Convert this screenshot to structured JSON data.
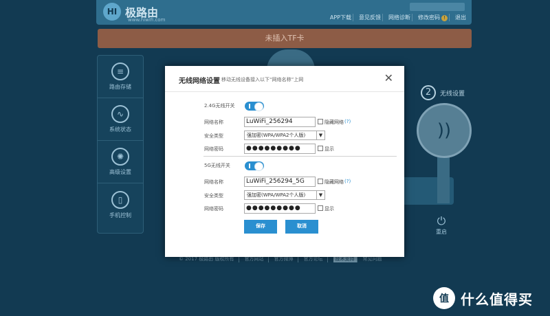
{
  "background": {
    "logo": {
      "name": "极路由",
      "sub": "www.hiwifi.com"
    },
    "topnav": [
      "APP下载",
      "意见反馈",
      "网络诊断",
      "修改密码",
      "退出"
    ],
    "banner": "未插入TF卡",
    "sidebar": [
      {
        "label": "路由存储",
        "icon": "database-icon"
      },
      {
        "label": "系统状态",
        "icon": "pulse-icon"
      },
      {
        "label": "高级设置",
        "icon": "gear-icon"
      },
      {
        "label": "手机控制",
        "icon": "phone-icon"
      }
    ],
    "step2": {
      "num": "2",
      "label": "无线设置"
    },
    "power_label": "重启",
    "footer": [
      "© 2017 极路由 版权所有",
      "官方网站",
      "官方微博",
      "官方论坛",
      "技术支持",
      "常见问题"
    ]
  },
  "modal": {
    "title": "无线网络设置",
    "subtitle": "移动无线设备接入以下“网络名称”上网",
    "close": "✕",
    "band24": {
      "toggle_label": "2.4G无线开关",
      "ssid_label": "网络名称",
      "ssid_value": "LuWiFi_256294",
      "hide_label": "隐藏网络",
      "help": "(?)",
      "security_label": "安全类型",
      "security_value": "强加密(WPA/WPA2个人版)",
      "password_label": "网络密码",
      "password_value": "●●●●●●●●●",
      "show_label": "显示"
    },
    "band5": {
      "toggle_label": "5G无线开关",
      "ssid_label": "网络名称",
      "ssid_value": "LuWiFi_256294_5G",
      "hide_label": "隐藏网络",
      "help": "(?)",
      "security_label": "安全类型",
      "security_value": "强加密(WPA/WPA2个人版)",
      "password_label": "网络密码",
      "password_value": "●●●●●●●●●",
      "show_label": "显示"
    },
    "save_label": "保存",
    "cancel_label": "取消"
  },
  "watermark": {
    "badge": "值",
    "text": "什么值得买"
  },
  "colors": {
    "accent": "#2a8fd0",
    "overlay": "#123a52"
  }
}
